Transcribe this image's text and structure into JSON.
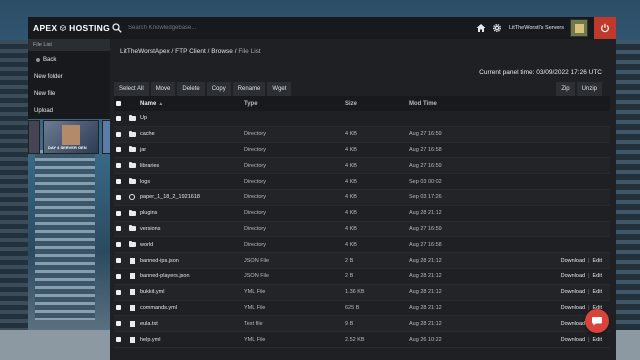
{
  "brand": {
    "name": "APEX HOSTING"
  },
  "search": {
    "placeholder": "Search Knowledgebase..."
  },
  "topbar": {
    "servers_label": "LitTheWorstl's Servers"
  },
  "sidebar": {
    "section_title": "File List",
    "items": [
      {
        "label": "Back"
      },
      {
        "label": "New folder"
      },
      {
        "label": "New file"
      },
      {
        "label": "Upload"
      }
    ],
    "thumbnail_caption": "DAY 4 SERVER GEN"
  },
  "breadcrumb": {
    "parts": [
      "LitTheWorstApex",
      "FTP Client",
      "Browse"
    ],
    "current": "File List"
  },
  "panel_time": "Current panel time: 03/09/2022 17:26 UTC",
  "toolbar": {
    "left": [
      "Select All",
      "Move",
      "Delete",
      "Copy",
      "Rename",
      "Wget"
    ],
    "right": [
      "Zip",
      "Unzip"
    ]
  },
  "table": {
    "headers": {
      "name": "Name",
      "type": "Type",
      "size": "Size",
      "modified": "Mod Time"
    },
    "rows": [
      {
        "icon": "folder-icon",
        "name": "Up",
        "type": "",
        "size": "",
        "modified": "",
        "actions": []
      },
      {
        "icon": "folder-icon",
        "name": "cache",
        "type": "Directory",
        "size": "4 KB",
        "modified": "Aug 27 16:59",
        "actions": []
      },
      {
        "icon": "folder-icon",
        "name": "jar",
        "type": "Directory",
        "size": "4 KB",
        "modified": "Aug 27 16:58",
        "actions": []
      },
      {
        "icon": "folder-icon",
        "name": "libraries",
        "type": "Directory",
        "size": "4 KB",
        "modified": "Aug 27 16:59",
        "actions": []
      },
      {
        "icon": "folder-icon",
        "name": "logs",
        "type": "Directory",
        "size": "4 KB",
        "modified": "Sep 03 00:02",
        "actions": []
      },
      {
        "icon": "globe-icon",
        "name": "paper_1_18_2_1921618",
        "type": "Directory",
        "size": "4 KB",
        "modified": "Sep 03 17:26",
        "actions": []
      },
      {
        "icon": "folder-icon",
        "name": "plugins",
        "type": "Directory",
        "size": "4 KB",
        "modified": "Aug 28 21:12",
        "actions": []
      },
      {
        "icon": "folder-icon",
        "name": "versions",
        "type": "Directory",
        "size": "4 KB",
        "modified": "Aug 27 16:59",
        "actions": []
      },
      {
        "icon": "folder-icon",
        "name": "world",
        "type": "Directory",
        "size": "4 KB",
        "modified": "Aug 27 16:58",
        "actions": []
      },
      {
        "icon": "file-icon",
        "name": "banned-ips.json",
        "type": "JSON File",
        "size": "2 B",
        "modified": "Aug 28 21:12",
        "actions": [
          "Download",
          "Edit"
        ]
      },
      {
        "icon": "file-icon",
        "name": "banned-players.json",
        "type": "JSON File",
        "size": "2 B",
        "modified": "Aug 28 21:12",
        "actions": [
          "Download",
          "Edit"
        ]
      },
      {
        "icon": "file-icon",
        "name": "bukkit.yml",
        "type": "YML File",
        "size": "1.36 KB",
        "modified": "Aug 28 21:12",
        "actions": [
          "Download",
          "Edit"
        ]
      },
      {
        "icon": "file-icon",
        "name": "commands.yml",
        "type": "YML File",
        "size": "625 B",
        "modified": "Aug 28 21:12",
        "actions": [
          "Download",
          "Edit"
        ]
      },
      {
        "icon": "file-icon",
        "name": "eula.txt",
        "type": "Text file",
        "size": "9 B",
        "modified": "Aug 28 21:12",
        "actions": [
          "Download",
          "Edit"
        ]
      },
      {
        "icon": "file-icon",
        "name": "help.yml",
        "type": "YML File",
        "size": "2.52 KB",
        "modified": "Aug 26 10:22",
        "actions": [
          "Download",
          "Edit"
        ]
      }
    ]
  },
  "colors": {
    "accent": "#d9433a",
    "panel_bg": "#1e2023",
    "topbar_bg": "#17191c"
  }
}
